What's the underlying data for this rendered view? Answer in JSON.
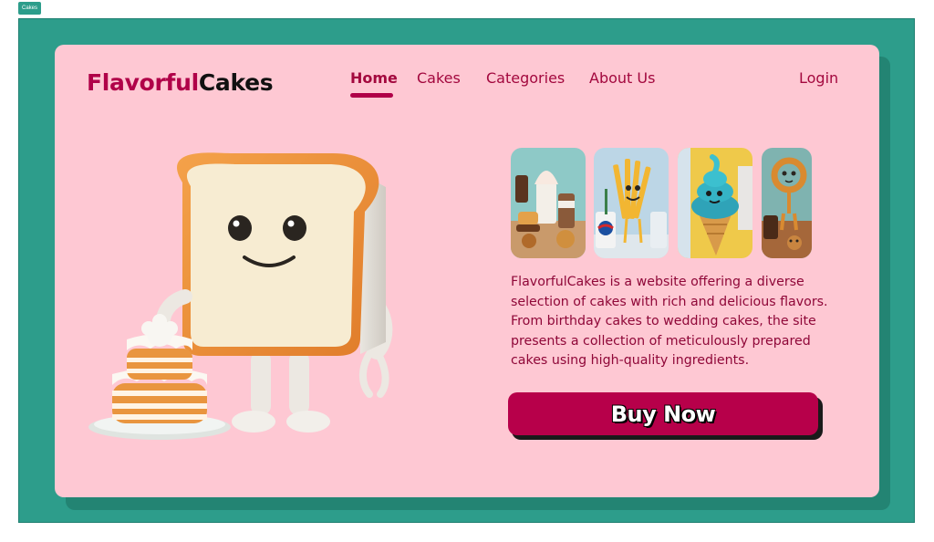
{
  "tab": {
    "label": "Cakes"
  },
  "brand": {
    "part1": "Flavorful",
    "part2": "Cakes"
  },
  "nav": {
    "items": [
      {
        "label": "Home"
      },
      {
        "label": "Cakes"
      },
      {
        "label": "Categories"
      },
      {
        "label": "About Us"
      }
    ],
    "login": "Login"
  },
  "hero": {
    "illustration": "toast-character-with-layer-cake"
  },
  "thumbnails": [
    {
      "subject": "ice-cream-and-snacks"
    },
    {
      "subject": "french-fries-character"
    },
    {
      "subject": "blue-ice-cream-cone"
    },
    {
      "subject": "pretzel-character"
    }
  ],
  "description": "FlavorfulCakes is a website offering a diverse selection of cakes with rich and delicious flavors. From birthday cakes to wedding cakes, the site presents a collection of meticulously prepared cakes using high-quality ingredients.",
  "cta": {
    "label": "Buy Now"
  },
  "colors": {
    "frame": "#2d9d8b",
    "card": "#fec8d3",
    "accent": "#b7004a",
    "text": "#a3083e"
  }
}
